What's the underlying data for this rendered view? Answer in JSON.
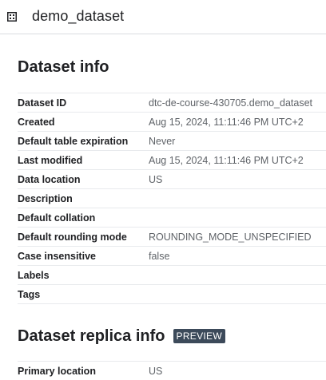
{
  "header": {
    "icon": "dataset-grid-icon",
    "title": "demo_dataset"
  },
  "dataset_info": {
    "title": "Dataset info",
    "rows": [
      {
        "key": "Dataset ID",
        "value": "dtc-de-course-430705.demo_dataset"
      },
      {
        "key": "Created",
        "value": "Aug 15, 2024, 11:11:46 PM UTC+2"
      },
      {
        "key": "Default table expiration",
        "value": "Never"
      },
      {
        "key": "Last modified",
        "value": "Aug 15, 2024, 11:11:46 PM UTC+2"
      },
      {
        "key": "Data location",
        "value": "US"
      },
      {
        "key": "Description",
        "value": ""
      },
      {
        "key": "Default collation",
        "value": ""
      },
      {
        "key": "Default rounding mode",
        "value": "ROUNDING_MODE_UNSPECIFIED"
      },
      {
        "key": "Case insensitive",
        "value": "false"
      },
      {
        "key": "Labels",
        "value": ""
      },
      {
        "key": "Tags",
        "value": ""
      }
    ]
  },
  "replica_info": {
    "title": "Dataset replica info",
    "badge": "PREVIEW",
    "rows": [
      {
        "key": "Primary location",
        "value": "US"
      }
    ]
  }
}
